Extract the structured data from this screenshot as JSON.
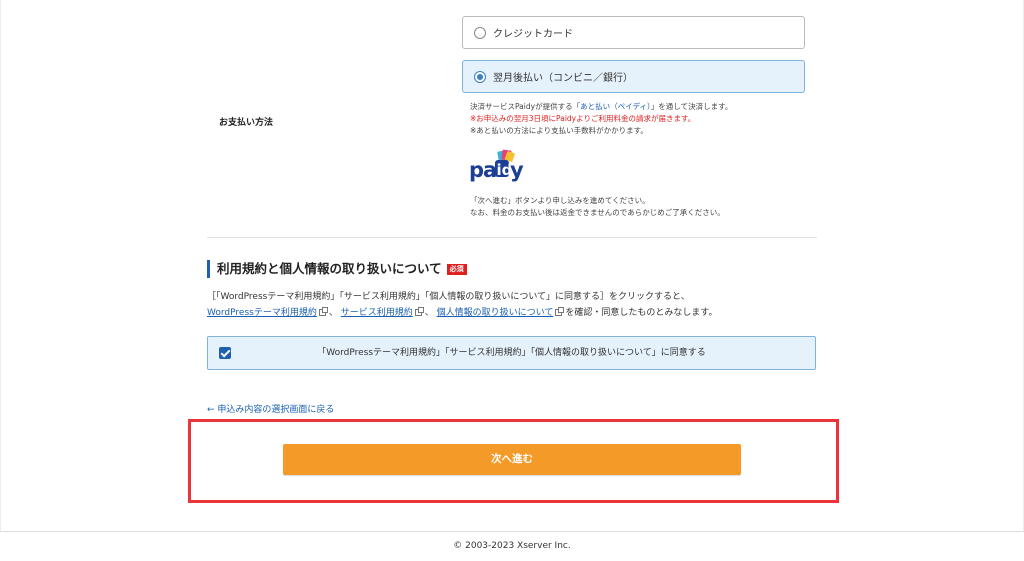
{
  "payment": {
    "label": "お支払い方法",
    "options": [
      {
        "label": "クレジットカード",
        "selected": false
      },
      {
        "label": "翌月後払い（コンビニ／銀行）",
        "selected": true
      }
    ],
    "notes": {
      "line1_pre": "決済サービスPaidyが提供する「",
      "line1_link": "あと払い（ペイディ）",
      "line1_post": "」を通して決済します。",
      "line2": "※お申込みの翌月3日頃にPaidyよりご利用料金の請求が届きます。",
      "line3": "※あと払いの方法により支払い手数料がかかります。"
    },
    "logo_text": "paidy",
    "instructions": [
      "「次へ進む」ボタンより申し込みを進めてください。",
      "なお、料金のお支払い後は返金できませんのであらかじめご了承ください。"
    ]
  },
  "terms": {
    "title": "利用規約と個人情報の取り扱いについて",
    "required_badge": "必須",
    "desc_line1": "［「WordPressテーマ利用規約」「サービス利用規約」「個人情報の取り扱いについて」に同意する］をクリックすると、",
    "link1": "WordPressテーマ利用規約",
    "sep1": "、",
    "link2": "サービス利用規約",
    "sep2": "、",
    "link3": "個人情報の取り扱いについて",
    "desc_tail": "を確認・同意したものとみなします。",
    "agree_label": "「WordPressテーマ利用規約」「サービス利用規約」「個人情報の取り扱いについて」に同意する",
    "agree_checked": true
  },
  "back_link": "← 申込み内容の選択画面に戻る",
  "next_button": "次へ進む",
  "footer": "© 2003-2023 Xserver Inc.",
  "colors": {
    "accent_blue": "#1f5fb0",
    "button_orange": "#f39a28",
    "highlight_red": "#e8343a",
    "selected_bg": "#e5f1fb"
  }
}
